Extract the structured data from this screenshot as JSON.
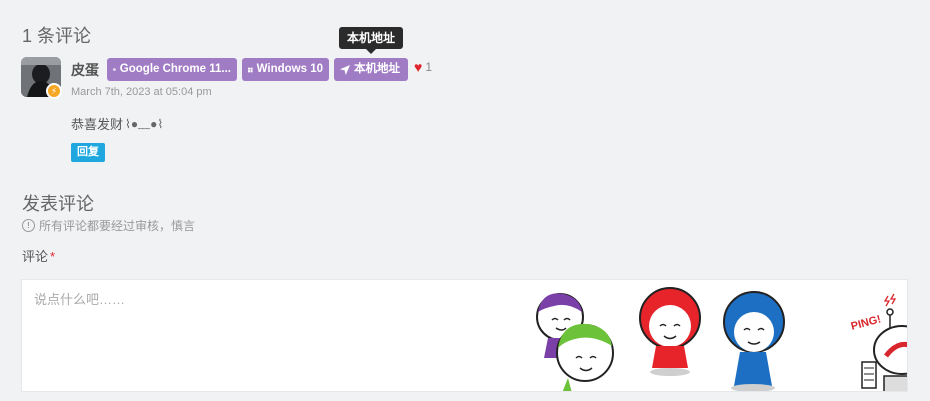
{
  "comments": {
    "title": "1 条评论",
    "items": [
      {
        "author": "皮蛋",
        "avatar_badge": "⚡",
        "tags": {
          "browser": "Google Chrome 11...",
          "os": "Windows 10",
          "location": "本机地址"
        },
        "tooltip": "本机地址",
        "likes": "1",
        "date": "March 7th, 2023 at 05:04 pm",
        "text": "恭喜发财",
        "emoji": "⌇●﹏●⌇",
        "reply_label": "回复"
      }
    ]
  },
  "form": {
    "title": "发表评论",
    "note": "所有评论都要经过审核，慎言",
    "field_label": "评论",
    "required_mark": "*",
    "placeholder": "说点什么吧……",
    "doodle_text": "PING!"
  },
  "colors": {
    "tag_bg": "#a07cc5",
    "reply_bg": "#1fa8e0",
    "heart": "#e0242b",
    "badge": "#f5a623"
  },
  "icons": {
    "browser": "chrome-icon",
    "os": "windows-icon",
    "location": "location-arrow-icon",
    "like": "heart-icon",
    "note": "info-circle-icon"
  }
}
